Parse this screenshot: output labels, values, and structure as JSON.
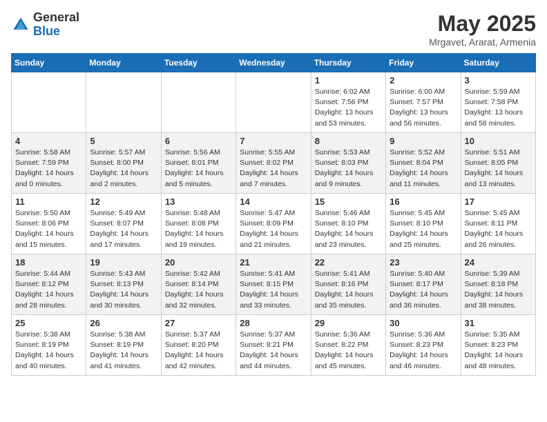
{
  "header": {
    "logo_general": "General",
    "logo_blue": "Blue",
    "month": "May 2025",
    "location": "Mrgavet, Ararat, Armenia"
  },
  "days_of_week": [
    "Sunday",
    "Monday",
    "Tuesday",
    "Wednesday",
    "Thursday",
    "Friday",
    "Saturday"
  ],
  "weeks": [
    [
      {
        "day": "",
        "sunrise": "",
        "sunset": "",
        "daylight": ""
      },
      {
        "day": "",
        "sunrise": "",
        "sunset": "",
        "daylight": ""
      },
      {
        "day": "",
        "sunrise": "",
        "sunset": "",
        "daylight": ""
      },
      {
        "day": "",
        "sunrise": "",
        "sunset": "",
        "daylight": ""
      },
      {
        "day": "1",
        "sunrise": "Sunrise: 6:02 AM",
        "sunset": "Sunset: 7:56 PM",
        "daylight": "Daylight: 13 hours and 53 minutes."
      },
      {
        "day": "2",
        "sunrise": "Sunrise: 6:00 AM",
        "sunset": "Sunset: 7:57 PM",
        "daylight": "Daylight: 13 hours and 56 minutes."
      },
      {
        "day": "3",
        "sunrise": "Sunrise: 5:59 AM",
        "sunset": "Sunset: 7:58 PM",
        "daylight": "Daylight: 13 hours and 58 minutes."
      }
    ],
    [
      {
        "day": "4",
        "sunrise": "Sunrise: 5:58 AM",
        "sunset": "Sunset: 7:59 PM",
        "daylight": "Daylight: 14 hours and 0 minutes."
      },
      {
        "day": "5",
        "sunrise": "Sunrise: 5:57 AM",
        "sunset": "Sunset: 8:00 PM",
        "daylight": "Daylight: 14 hours and 2 minutes."
      },
      {
        "day": "6",
        "sunrise": "Sunrise: 5:56 AM",
        "sunset": "Sunset: 8:01 PM",
        "daylight": "Daylight: 14 hours and 5 minutes."
      },
      {
        "day": "7",
        "sunrise": "Sunrise: 5:55 AM",
        "sunset": "Sunset: 8:02 PM",
        "daylight": "Daylight: 14 hours and 7 minutes."
      },
      {
        "day": "8",
        "sunrise": "Sunrise: 5:53 AM",
        "sunset": "Sunset: 8:03 PM",
        "daylight": "Daylight: 14 hours and 9 minutes."
      },
      {
        "day": "9",
        "sunrise": "Sunrise: 5:52 AM",
        "sunset": "Sunset: 8:04 PM",
        "daylight": "Daylight: 14 hours and 11 minutes."
      },
      {
        "day": "10",
        "sunrise": "Sunrise: 5:51 AM",
        "sunset": "Sunset: 8:05 PM",
        "daylight": "Daylight: 14 hours and 13 minutes."
      }
    ],
    [
      {
        "day": "11",
        "sunrise": "Sunrise: 5:50 AM",
        "sunset": "Sunset: 8:06 PM",
        "daylight": "Daylight: 14 hours and 15 minutes."
      },
      {
        "day": "12",
        "sunrise": "Sunrise: 5:49 AM",
        "sunset": "Sunset: 8:07 PM",
        "daylight": "Daylight: 14 hours and 17 minutes."
      },
      {
        "day": "13",
        "sunrise": "Sunrise: 5:48 AM",
        "sunset": "Sunset: 8:08 PM",
        "daylight": "Daylight: 14 hours and 19 minutes."
      },
      {
        "day": "14",
        "sunrise": "Sunrise: 5:47 AM",
        "sunset": "Sunset: 8:09 PM",
        "daylight": "Daylight: 14 hours and 21 minutes."
      },
      {
        "day": "15",
        "sunrise": "Sunrise: 5:46 AM",
        "sunset": "Sunset: 8:10 PM",
        "daylight": "Daylight: 14 hours and 23 minutes."
      },
      {
        "day": "16",
        "sunrise": "Sunrise: 5:45 AM",
        "sunset": "Sunset: 8:10 PM",
        "daylight": "Daylight: 14 hours and 25 minutes."
      },
      {
        "day": "17",
        "sunrise": "Sunrise: 5:45 AM",
        "sunset": "Sunset: 8:11 PM",
        "daylight": "Daylight: 14 hours and 26 minutes."
      }
    ],
    [
      {
        "day": "18",
        "sunrise": "Sunrise: 5:44 AM",
        "sunset": "Sunset: 8:12 PM",
        "daylight": "Daylight: 14 hours and 28 minutes."
      },
      {
        "day": "19",
        "sunrise": "Sunrise: 5:43 AM",
        "sunset": "Sunset: 8:13 PM",
        "daylight": "Daylight: 14 hours and 30 minutes."
      },
      {
        "day": "20",
        "sunrise": "Sunrise: 5:42 AM",
        "sunset": "Sunset: 8:14 PM",
        "daylight": "Daylight: 14 hours and 32 minutes."
      },
      {
        "day": "21",
        "sunrise": "Sunrise: 5:41 AM",
        "sunset": "Sunset: 8:15 PM",
        "daylight": "Daylight: 14 hours and 33 minutes."
      },
      {
        "day": "22",
        "sunrise": "Sunrise: 5:41 AM",
        "sunset": "Sunset: 8:16 PM",
        "daylight": "Daylight: 14 hours and 35 minutes."
      },
      {
        "day": "23",
        "sunrise": "Sunrise: 5:40 AM",
        "sunset": "Sunset: 8:17 PM",
        "daylight": "Daylight: 14 hours and 36 minutes."
      },
      {
        "day": "24",
        "sunrise": "Sunrise: 5:39 AM",
        "sunset": "Sunset: 8:18 PM",
        "daylight": "Daylight: 14 hours and 38 minutes."
      }
    ],
    [
      {
        "day": "25",
        "sunrise": "Sunrise: 5:38 AM",
        "sunset": "Sunset: 8:19 PM",
        "daylight": "Daylight: 14 hours and 40 minutes."
      },
      {
        "day": "26",
        "sunrise": "Sunrise: 5:38 AM",
        "sunset": "Sunset: 8:19 PM",
        "daylight": "Daylight: 14 hours and 41 minutes."
      },
      {
        "day": "27",
        "sunrise": "Sunrise: 5:37 AM",
        "sunset": "Sunset: 8:20 PM",
        "daylight": "Daylight: 14 hours and 42 minutes."
      },
      {
        "day": "28",
        "sunrise": "Sunrise: 5:37 AM",
        "sunset": "Sunset: 8:21 PM",
        "daylight": "Daylight: 14 hours and 44 minutes."
      },
      {
        "day": "29",
        "sunrise": "Sunrise: 5:36 AM",
        "sunset": "Sunset: 8:22 PM",
        "daylight": "Daylight: 14 hours and 45 minutes."
      },
      {
        "day": "30",
        "sunrise": "Sunrise: 5:36 AM",
        "sunset": "Sunset: 8:23 PM",
        "daylight": "Daylight: 14 hours and 46 minutes."
      },
      {
        "day": "31",
        "sunrise": "Sunrise: 5:35 AM",
        "sunset": "Sunset: 8:23 PM",
        "daylight": "Daylight: 14 hours and 48 minutes."
      }
    ]
  ]
}
